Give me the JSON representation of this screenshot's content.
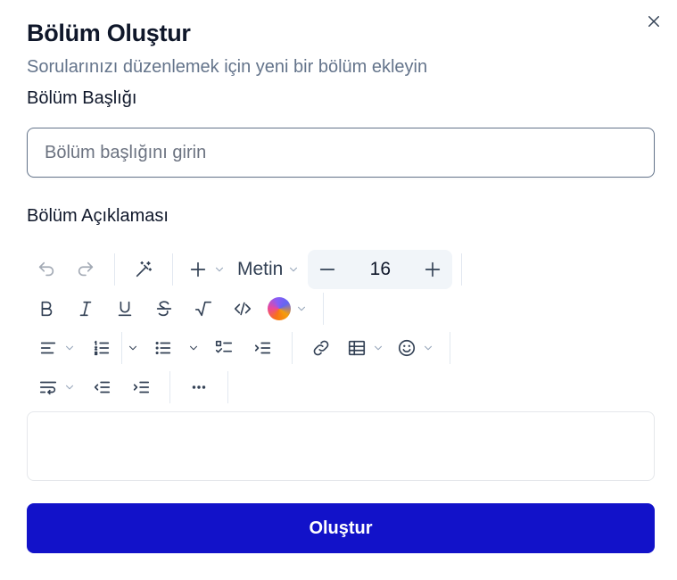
{
  "dialog": {
    "title": "Bölüm Oluştur",
    "subtitle": "Sorularınızı düzenlemek için yeni bir bölüm ekleyin",
    "close_icon": "close-icon"
  },
  "form": {
    "title_label": "Bölüm Başlığı",
    "title_placeholder": "Bölüm başlığını girin",
    "title_value": "",
    "description_label": "Bölüm Açıklaması",
    "description_value": ""
  },
  "toolbar": {
    "text_style": "Metin",
    "font_size": "16",
    "icons": {
      "row1": [
        "undo-icon",
        "redo-icon",
        "magic-wand-icon",
        "plus-icon",
        "chevron-down-icon",
        "minus-icon",
        "plus-icon"
      ],
      "row2": [
        "bold-icon",
        "italic-icon",
        "underline-icon",
        "strikethrough-icon",
        "sqrt-icon",
        "code-icon",
        "color-picker-icon"
      ],
      "row3": [
        "align-left-icon",
        "ordered-list-icon",
        "bullet-list-icon",
        "task-list-icon",
        "blockquote-list-icon",
        "link-icon",
        "table-icon",
        "emoji-icon"
      ],
      "row4": [
        "text-wrap-icon",
        "outdent-icon",
        "indent-icon",
        "more-icon"
      ]
    }
  },
  "actions": {
    "submit_label": "Oluştur"
  },
  "colors": {
    "primary": "#1212c9",
    "muted_text": "#64748b",
    "border": "#64748b"
  }
}
